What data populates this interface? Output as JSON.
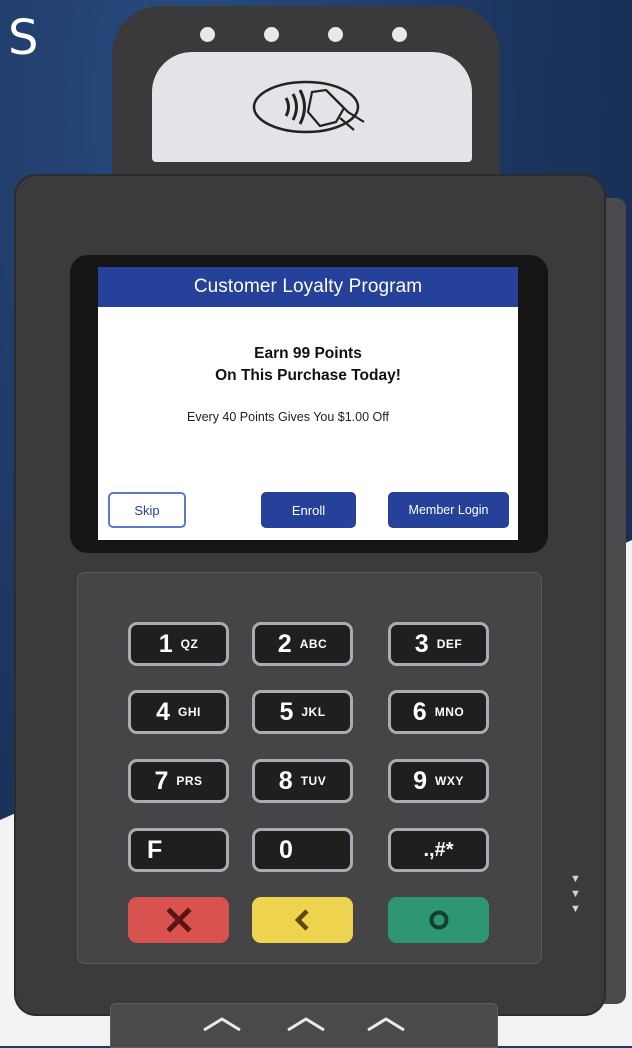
{
  "corner_text": "S",
  "screen": {
    "title": "Customer Loyalty Program",
    "headline_line1": "Earn 99 Points",
    "headline_line2": "On This Purchase Today!",
    "subline": "Every 40 Points Gives You $1.00 Off",
    "buttons": {
      "skip": "Skip",
      "enroll": "Enroll",
      "member_login": "Member Login"
    }
  },
  "keypad": {
    "keys": [
      {
        "num": "1",
        "letters": "QZ"
      },
      {
        "num": "2",
        "letters": "ABC"
      },
      {
        "num": "3",
        "letters": "DEF"
      },
      {
        "num": "4",
        "letters": "GHI"
      },
      {
        "num": "5",
        "letters": "JKL"
      },
      {
        "num": "6",
        "letters": "MNO"
      },
      {
        "num": "7",
        "letters": "PRS"
      },
      {
        "num": "8",
        "letters": "TUV"
      },
      {
        "num": "9",
        "letters": "WXY"
      },
      {
        "num": "F",
        "letters": ""
      },
      {
        "num": "0",
        "letters": ""
      },
      {
        "num": ".,#*",
        "letters": ""
      }
    ],
    "function_keys": [
      "cancel-x-icon",
      "back-arrow-icon",
      "ok-circle-icon"
    ]
  },
  "colors": {
    "screen_header": "#25419a",
    "cancel_key": "#d8534f",
    "back_key": "#eed34e",
    "ok_key": "#2f9675"
  }
}
